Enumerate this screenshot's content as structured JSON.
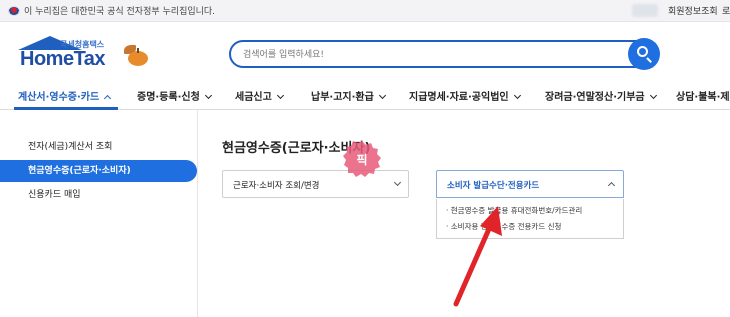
{
  "gov_bar": {
    "notice": "이 누리집은 대한민국 공식 전자정부 누리집입니다.",
    "member_info": "회원정보조회",
    "login": "로"
  },
  "header": {
    "logo_sub": "국세청홈택스",
    "logo_main": "HomeTax",
    "search_placeholder": "검색어를 입력하세요!"
  },
  "gnb": {
    "items": [
      {
        "label": "계산서·영수증·카드",
        "active": true
      },
      {
        "label": "증명·등록·신청"
      },
      {
        "label": "세금신고"
      },
      {
        "label": "납부·고지·환급"
      },
      {
        "label": "지급명세·자료·공익법인"
      },
      {
        "label": "장려금·연말정산·기부금"
      },
      {
        "label": "상담·불복·제"
      }
    ]
  },
  "lnb": {
    "items": [
      {
        "label": "전자(세금)계산서 조회"
      },
      {
        "label": "현금영수증(근로자·소비자)",
        "active": true
      },
      {
        "label": "신용카드 매입"
      }
    ]
  },
  "content": {
    "title": "현금영수증(근로자·소비자)",
    "select_left": "근로자·소비자 조회/변경",
    "select_right": "소비자 발급수단·전용카드",
    "dropdown_items": [
      "· 현금영수증 발급용 휴대전화번호/카드관리",
      "· 소비자용 현금영수증 전용카드 신청"
    ],
    "stamp_text": "픽"
  },
  "colors": {
    "accent": "#1f5fbf",
    "accent_bright": "#1f6fe0",
    "stamp": "#e85b7a",
    "arrow": "#e0242a"
  }
}
